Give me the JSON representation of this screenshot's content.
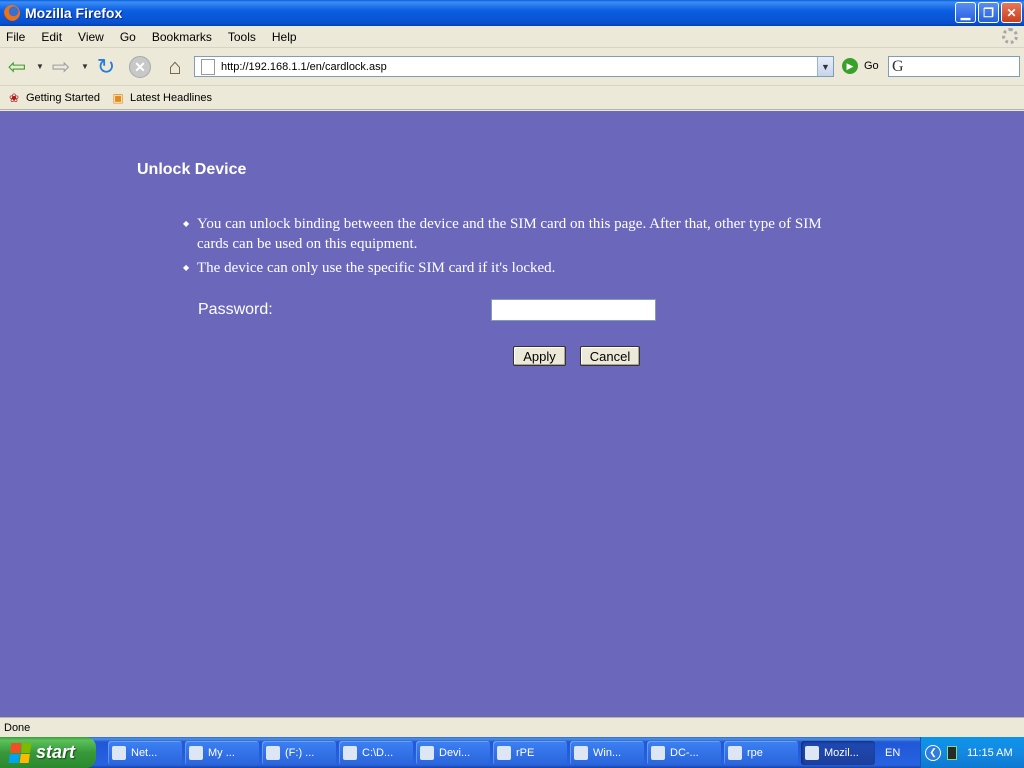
{
  "window": {
    "title": "Mozilla Firefox"
  },
  "menu": {
    "items": [
      "File",
      "Edit",
      "View",
      "Go",
      "Bookmarks",
      "Tools",
      "Help"
    ]
  },
  "navigation": {
    "url": "http://192.168.1.1/en/cardlock.asp",
    "go_label": "Go",
    "search_placeholder": ""
  },
  "bookmarks": {
    "items": [
      {
        "label": "Getting Started",
        "icon": "getting-started-icon"
      },
      {
        "label": "Latest Headlines",
        "icon": "rss-icon"
      }
    ]
  },
  "page": {
    "title": "Unlock Device",
    "bullets": [
      "You can unlock binding between the device and the SIM card on this page. After that, other type of SIM cards can be used on this equipment.",
      "The device can only use the specific SIM card if it's locked."
    ],
    "password_label": "Password:",
    "password_value": "",
    "apply_label": "Apply",
    "cancel_label": "Cancel",
    "background_color": "#6b67bb"
  },
  "status": {
    "text": "Done"
  },
  "taskbar": {
    "start_label": "start",
    "tasks": [
      {
        "label": "Net...",
        "active": false
      },
      {
        "label": "My ...",
        "active": false
      },
      {
        "label": "(F:) ...",
        "active": false
      },
      {
        "label": "C:\\D...",
        "active": false
      },
      {
        "label": "Devi...",
        "active": false
      },
      {
        "label": "rPE",
        "active": false
      },
      {
        "label": "Win...",
        "active": false
      },
      {
        "label": "DC-...",
        "active": false
      },
      {
        "label": "rpe",
        "active": false
      },
      {
        "label": "Mozil...",
        "active": true
      }
    ],
    "language": "EN",
    "clock": "11:15 AM"
  }
}
